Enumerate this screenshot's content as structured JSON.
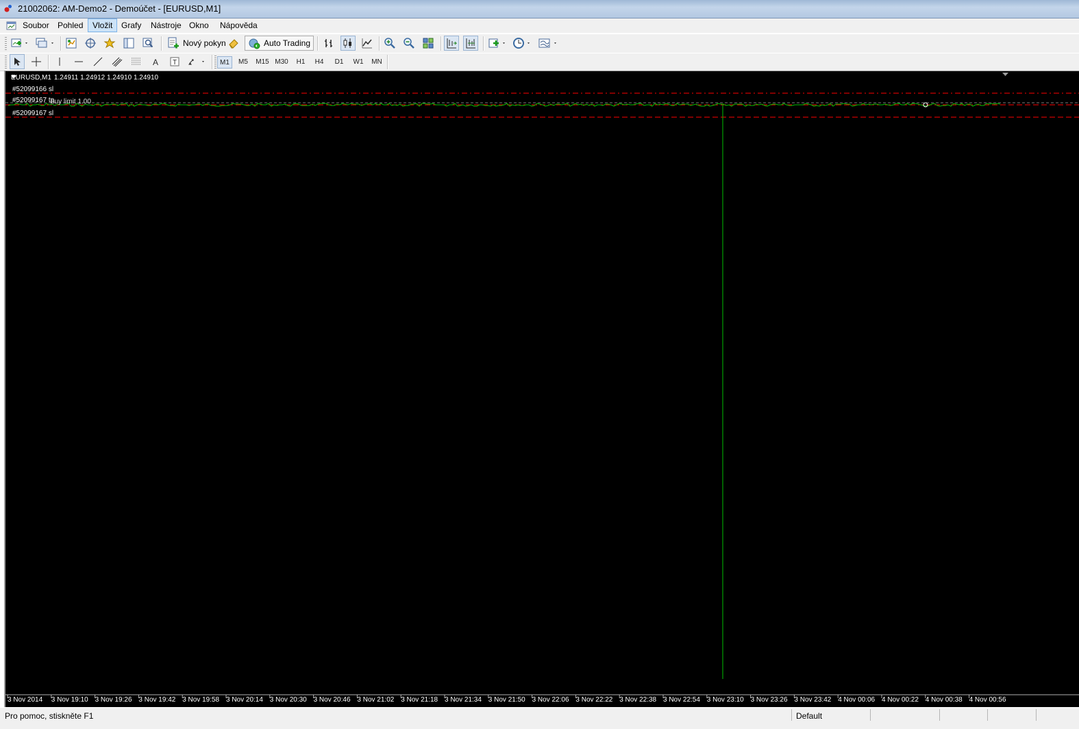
{
  "window": {
    "title": "21002062: AM-Demo2 - Demoúčet - [EURUSD,M1]"
  },
  "menu": {
    "items": [
      {
        "label": "Soubor",
        "active": false
      },
      {
        "label": "Pohled",
        "active": false
      },
      {
        "label": "Vložit",
        "active": true
      },
      {
        "label": "Grafy",
        "active": false
      },
      {
        "label": "Nástroje",
        "active": false
      },
      {
        "label": "Okno",
        "active": false
      },
      {
        "label": "Nápověda",
        "active": false
      }
    ]
  },
  "toolbar": {
    "new_order_label": "Nový pokyn",
    "auto_trading_label": "Auto Trading"
  },
  "periods": [
    "M1",
    "M5",
    "M15",
    "M30",
    "H1",
    "H4",
    "D1",
    "W1",
    "MN"
  ],
  "selected_period": "M1",
  "chart": {
    "symbol_period": "EURUSD,M1",
    "ohlc": "1.24911 1.24912 1.24910 1.24910",
    "orders": [
      {
        "label": "#52099166 sl"
      },
      {
        "label": "#52099167 tp"
      },
      {
        "label": "#52099167 sl"
      }
    ],
    "pending_label": "buy limit 1.00",
    "time_labels": [
      "3 Nov 2014",
      "3 Nov 19:10",
      "3 Nov 19:26",
      "3 Nov 19:42",
      "3 Nov 19:58",
      "3 Nov 20:14",
      "3 Nov 20:30",
      "3 Nov 20:46",
      "3 Nov 21:02",
      "3 Nov 21:18",
      "3 Nov 21:34",
      "3 Nov 21:50",
      "3 Nov 22:06",
      "3 Nov 22:22",
      "3 Nov 22:38",
      "3 Nov 22:54",
      "3 Nov 23:10",
      "3 Nov 23:26",
      "3 Nov 23:42",
      "4 Nov 00:06",
      "4 Nov 00:22",
      "4 Nov 00:38",
      "4 Nov 00:56"
    ],
    "colors": {
      "background": "#000000",
      "price_line": "#00c000",
      "order_line": "#ff0000",
      "text": "#ffffff"
    }
  },
  "status": {
    "help_text": "Pro pomoc, stiskněte F1",
    "profile": "Default"
  }
}
